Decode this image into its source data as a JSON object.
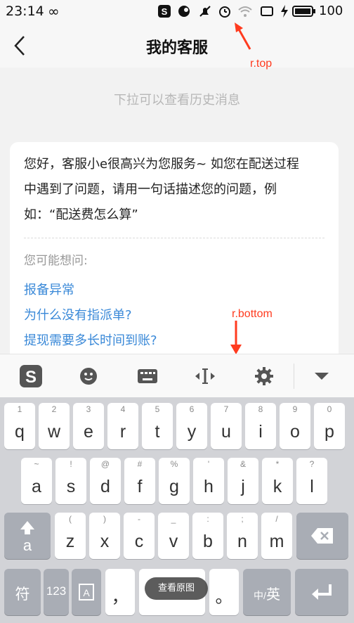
{
  "status_bar": {
    "time": "23:14",
    "infinity": "∞",
    "battery_label": "100"
  },
  "header": {
    "title": "我的客服",
    "back_icon": "chevron-left-icon"
  },
  "annotations": {
    "top": "r.top",
    "bottom": "r.bottom",
    "color": "#ff3b1f"
  },
  "chat": {
    "pull_hint": "下拉可以查看历史消息",
    "greeting_lines": [
      "您好，客服小e很高兴为您服务~ 如您在配送过程",
      "中遇到了问题，请用一句话描述您的问题，例",
      "如：“配送费怎么算”"
    ],
    "ask_label": "您可能想问:",
    "questions": [
      "报备异常",
      "为什么没有指派单?",
      "提现需要多长时间到账?"
    ],
    "link_color": "#3a89d8"
  },
  "keyboard_toolbar": {
    "icons": [
      "sogou-logo-icon",
      "emoji-icon",
      "keyboard-icon",
      "cursor-icon",
      "settings-icon",
      "collapse-icon"
    ]
  },
  "keyboard": {
    "row1": [
      {
        "hint": "1",
        "key": "q"
      },
      {
        "hint": "2",
        "key": "w"
      },
      {
        "hint": "3",
        "key": "e"
      },
      {
        "hint": "4",
        "key": "r"
      },
      {
        "hint": "5",
        "key": "t"
      },
      {
        "hint": "6",
        "key": "y"
      },
      {
        "hint": "7",
        "key": "u"
      },
      {
        "hint": "8",
        "key": "i"
      },
      {
        "hint": "9",
        "key": "o"
      },
      {
        "hint": "0",
        "key": "p"
      }
    ],
    "row2": [
      {
        "hint": "~",
        "key": "a"
      },
      {
        "hint": "!",
        "key": "s"
      },
      {
        "hint": "@",
        "key": "d"
      },
      {
        "hint": "#",
        "key": "f"
      },
      {
        "hint": "%",
        "key": "g"
      },
      {
        "hint": "'",
        "key": "h"
      },
      {
        "hint": "&",
        "key": "j"
      },
      {
        "hint": "*",
        "key": "k"
      },
      {
        "hint": "?",
        "key": "l"
      }
    ],
    "row3": [
      {
        "hint": "(",
        "key": "z"
      },
      {
        "hint": ")",
        "key": "x"
      },
      {
        "hint": "-",
        "key": "c"
      },
      {
        "hint": "_",
        "key": "v"
      },
      {
        "hint": ":",
        "key": "b"
      },
      {
        "hint": ";",
        "key": "n"
      },
      {
        "hint": "/",
        "key": "m"
      }
    ],
    "shift_label": "a",
    "symbol_key": "符",
    "num_key": "123",
    "comma_key": "，",
    "period_key": "。",
    "lang_key_prefix": "中/",
    "lang_key_main": "英"
  },
  "toast": "查看原图"
}
